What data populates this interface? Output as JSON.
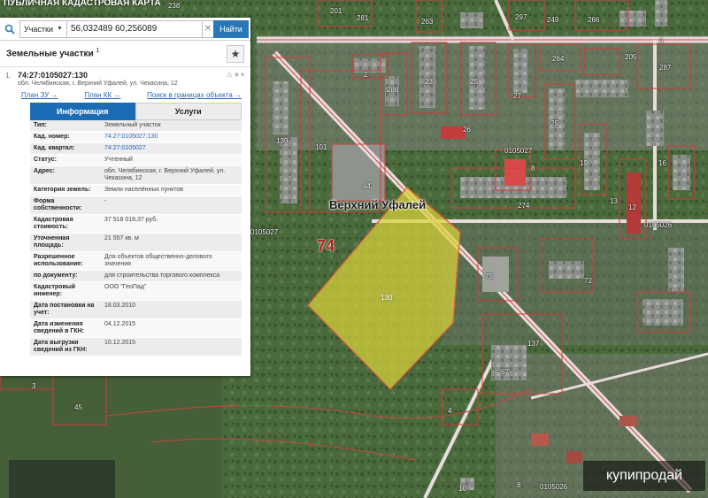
{
  "header": {
    "title": "ПУБЛИЧНАЯ КАДАСТРОВАЯ КАРТА"
  },
  "search": {
    "type": "Участки",
    "value": "56,032489 60,256089",
    "find_label": "Найти"
  },
  "panel": {
    "title": "Земельные участки",
    "count_sup": "1",
    "item": {
      "num": "1.",
      "cadnum": "74:27:0105027:130",
      "address": "обл. Челябинская, г. Верхний Уфалей, ул. Чекасина, 12",
      "links": [
        "План ЗУ →",
        "План КК →",
        "Поиск в границах объекта →"
      ]
    },
    "tabs": {
      "info": "Информация",
      "services": "Услуги"
    },
    "attributes": [
      {
        "k": "Тип:",
        "v": "Земельный участок",
        "link": false
      },
      {
        "k": "Кад. номер:",
        "v": "74:27:0105027:130",
        "link": true
      },
      {
        "k": "Кад. квартал:",
        "v": "74:27:0105027",
        "link": true
      },
      {
        "k": "Статус:",
        "v": "Учтенный",
        "link": false
      },
      {
        "k": "Адрес:",
        "v": "обл. Челябинская, г. Верхний Уфалей, ул. Чекасина, 12",
        "link": false
      },
      {
        "k": "Категория земель:",
        "v": "Земли населённых пунктов",
        "link": false
      },
      {
        "k": "Форма собственности:",
        "v": "-",
        "link": false
      },
      {
        "k": "Кадастровая стоимость:",
        "v": "37 518 018,37 руб.",
        "link": false
      },
      {
        "k": "Уточненная площадь:",
        "v": "21 557 кв. м",
        "link": false
      },
      {
        "k": "Разрешенное использование:",
        "v": "Для объектов общественно-делового значения",
        "link": false
      },
      {
        "k": "по документу:",
        "v": "для строительства торгового комплекса",
        "link": false
      },
      {
        "k": "Кадастровый инженер:",
        "v": "ООО \"ГеоПад\"",
        "link": false
      },
      {
        "k": "Дата постановки на учет:",
        "v": "18.03.2010",
        "link": false
      },
      {
        "k": "Дата изменения сведений в ГКН:",
        "v": "04.12.2015",
        "link": false
      },
      {
        "k": "Дата выгрузки сведений из ГКН:",
        "v": "10.12.2015",
        "link": false
      }
    ]
  },
  "map": {
    "city": "Верхний Уфалей",
    "region": "74",
    "selected_parcel": "130",
    "parcel_labels": [
      "201",
      "281",
      "263",
      "297",
      "249",
      "266",
      "238",
      "2",
      "286",
      "23",
      "25",
      "264",
      "205",
      "287",
      "139",
      "101",
      "44",
      "3",
      "27",
      "19",
      "25",
      "26",
      "0105027",
      "8",
      "274",
      "16",
      "13",
      "12",
      "0105026",
      "0105027",
      "75",
      "137",
      "67",
      "72",
      "4",
      "10",
      "8",
      "0105026",
      "027",
      "19",
      "45",
      "3"
    ],
    "colors": {
      "parcel_fill": "#d9d23a",
      "boundary": "#d23a3a",
      "road": "#efe4e4",
      "region": "#b3231e"
    }
  },
  "watermark": "купипродай"
}
